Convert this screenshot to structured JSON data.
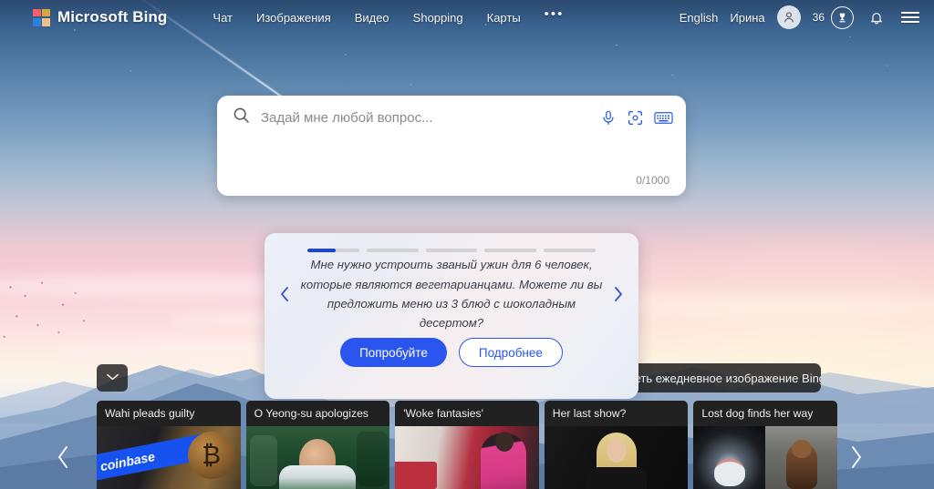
{
  "header": {
    "brand": "Microsoft Bing",
    "logo_icon": "microsoft-logo-icon",
    "nav": [
      {
        "label": "Чат",
        "name": "nav-chat"
      },
      {
        "label": "Изображения",
        "name": "nav-images"
      },
      {
        "label": "Видео",
        "name": "nav-video"
      },
      {
        "label": "Shopping",
        "name": "nav-shopping"
      },
      {
        "label": "Карты",
        "name": "nav-maps"
      }
    ],
    "more_label": "•••",
    "language": "English",
    "user_name": "Ирина",
    "avatar_icon": "person-avatar-icon",
    "rewards_points": "36",
    "rewards_icon": "rewards-trophy-icon",
    "notifications_icon": "bell-icon",
    "menu_icon": "hamburger-menu-icon"
  },
  "search": {
    "placeholder": "Задай мне любой вопрос...",
    "value": "",
    "counter": "0/1000",
    "search_icon": "search-magnifier-icon",
    "mic_icon": "microphone-icon",
    "lens_icon": "visual-search-camera-icon",
    "keyboard_icon": "keyboard-icon"
  },
  "suggestion_card": {
    "progress": {
      "segments": 5,
      "active_index": 0,
      "active_fill_percent": 55,
      "active_color": "#1b44d8",
      "track_color": "#d2d2d2"
    },
    "prev_icon": "chevron-left-icon",
    "next_icon": "chevron-right-icon",
    "prompt": "Мне нужно устроить званый ужин для 6 человек, которые являются вегетарианцами. Можете ли вы предложить меню из 3 блюд с шоколадным десертом?",
    "primary_button": "Попробуйте",
    "secondary_button": "Подробнее"
  },
  "news": {
    "collapse_icon": "chevron-down-icon",
    "daily_image_tooltip": "Хотите увидеть ежедневное изображение Bing?",
    "prev_icon": "chevron-left-icon",
    "next_icon": "chevron-right-icon",
    "cards": [
      {
        "title": "Wahi pleads guilty",
        "thumb": "th-coinbase"
      },
      {
        "title": "O Yeong-su apologizes",
        "thumb": "th-yeongsu"
      },
      {
        "title": "'Woke fantasies'",
        "thumb": "th-woke"
      },
      {
        "title": "Her last show?",
        "thumb": "th-herlast"
      },
      {
        "title": "Lost dog finds her way",
        "thumb": "th-lostdog"
      }
    ]
  },
  "colors": {
    "accent_blue": "#2b55ef",
    "progress_blue": "#1b44d8",
    "icon_blue": "#2b5ce6",
    "card_dark": "#212121",
    "sky_top": "#2b4a70",
    "sky_pink": "#f7cdd6",
    "sky_warm": "#fdf4ea"
  }
}
